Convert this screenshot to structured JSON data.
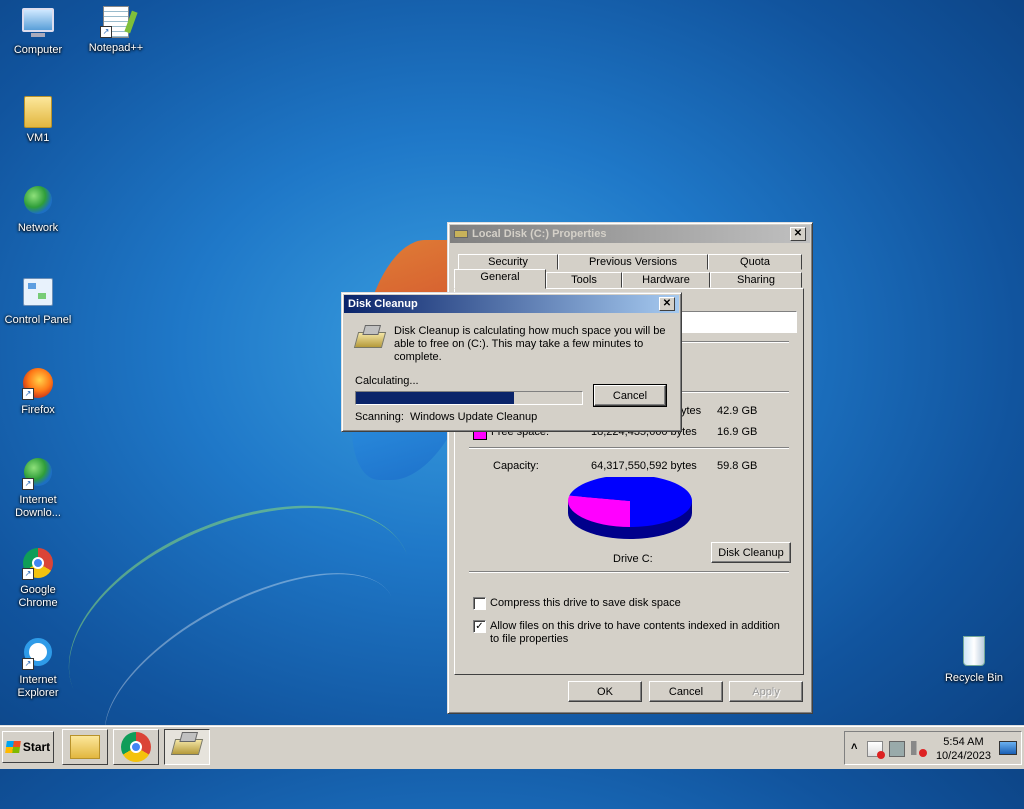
{
  "desktop": {
    "icons": [
      {
        "label": "Computer"
      },
      {
        "label": "Notepad++"
      },
      {
        "label": "VM1"
      },
      {
        "label": "Network"
      },
      {
        "label": "Control Panel"
      },
      {
        "label": "Firefox"
      },
      {
        "label": "Internet Downlo..."
      },
      {
        "label": "Google Chrome"
      },
      {
        "label": "Internet Explorer"
      },
      {
        "label": "Recycle Bin"
      }
    ]
  },
  "properties": {
    "title": "Local Disk (C:) Properties",
    "close": "✕",
    "tabs_top": [
      "Security",
      "Previous Versions",
      "Quota"
    ],
    "tabs_bottom": [
      "General",
      "Tools",
      "Hardware",
      "Sharing"
    ],
    "used_bytes": "ytes",
    "used_gb": "42.9 GB",
    "free_label": "Free space:",
    "free_bytes": "18,224,435,660 bytes",
    "free_gb": "16.9 GB",
    "capacity_label": "Capacity:",
    "capacity_bytes": "64,317,550,592 bytes",
    "capacity_gb": "59.8 GB",
    "drive_label": "Drive C:",
    "disk_cleanup_button": "Disk Cleanup",
    "compress_label": "Compress this drive to save disk space",
    "compress_checked": false,
    "index_label": "Allow files on this drive to have contents indexed in addition to file properties",
    "index_checked": true,
    "ok": "OK",
    "cancel": "Cancel",
    "apply": "Apply",
    "colors": {
      "used": "#0000ff",
      "free": "#ff00ff"
    },
    "used_fraction": 0.717
  },
  "cleanup": {
    "title": "Disk Cleanup",
    "close": "✕",
    "message": "Disk Cleanup is calculating how much space you will be able to free on  (C:). This may take a few minutes to complete.",
    "status": "Calculating...",
    "progress": 0.7,
    "cancel": "Cancel",
    "scanning_label": "Scanning:",
    "scanning_item": "Windows Update Cleanup"
  },
  "taskbar": {
    "start": "Start",
    "time": "5:54 AM",
    "date": "10/24/2023",
    "tray_chevron": "˄"
  }
}
